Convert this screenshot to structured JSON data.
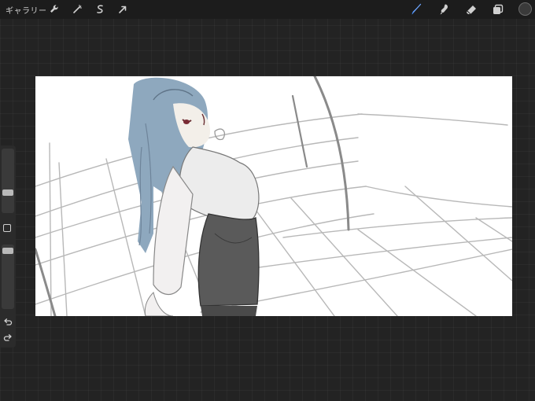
{
  "app": {
    "gallery_label": "ギャラリー"
  },
  "toolbar": {
    "left_tools": [
      "wrench-icon",
      "magic-wand-icon",
      "selection-icon",
      "transform-icon"
    ],
    "right_tools": [
      "brush-icon",
      "smudge-icon",
      "eraser-icon",
      "layers-icon"
    ],
    "active_tool": "brush",
    "active_color": "#3a3a3a",
    "brush_accent": "#3d7fe0"
  },
  "sidebar": {
    "brush_size_level": 0.3,
    "opacity_level": 0.95
  },
  "artwork": {
    "hair_color": "#8ea8be",
    "dress_color": "#5a5a5a",
    "background": "#ffffff"
  }
}
